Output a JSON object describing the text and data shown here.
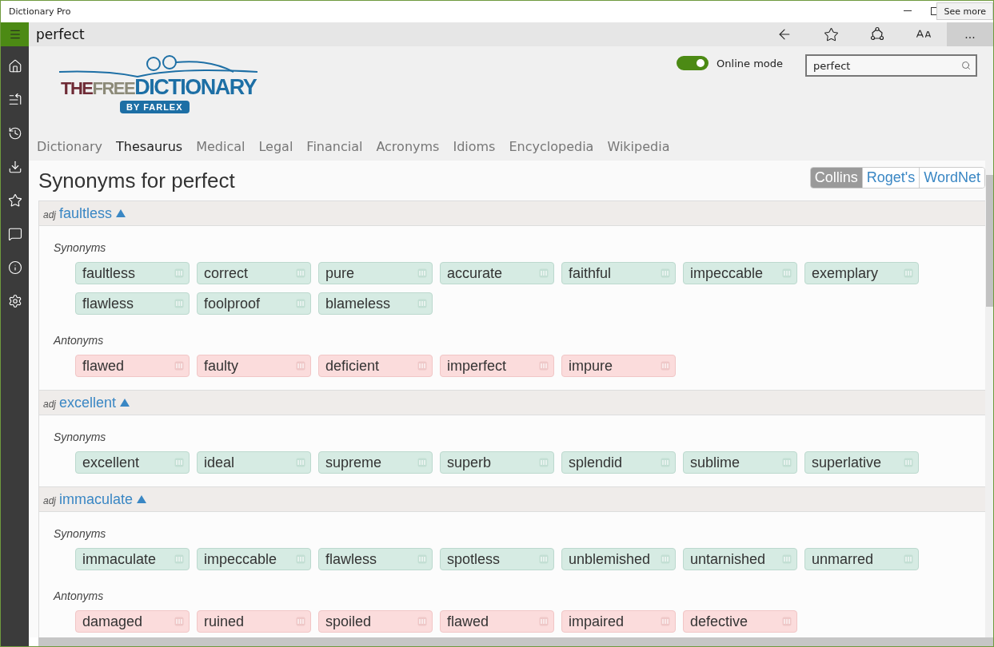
{
  "window": {
    "title": "Dictionary Pro",
    "tooltip": "See more"
  },
  "app_bar": {
    "query": "perfect",
    "more_button": "..."
  },
  "online_mode": {
    "label": "Online mode",
    "on": true
  },
  "search": {
    "value": "perfect"
  },
  "logo": {
    "the": "THE",
    "free": "FREE",
    "dictionary": "DICTIONARY",
    "byline": "BY FARLEX"
  },
  "tabs": [
    {
      "label": "Dictionary",
      "selected": false
    },
    {
      "label": "Thesaurus",
      "selected": true
    },
    {
      "label": "Medical",
      "selected": false
    },
    {
      "label": "Legal",
      "selected": false
    },
    {
      "label": "Financial",
      "selected": false
    },
    {
      "label": "Acronyms",
      "selected": false
    },
    {
      "label": "Idioms",
      "selected": false
    },
    {
      "label": "Encyclopedia",
      "selected": false
    },
    {
      "label": "Wikipedia",
      "selected": false
    }
  ],
  "heading": "Synonyms for perfect",
  "sources": [
    {
      "label": "Collins",
      "selected": true
    },
    {
      "label": "Roget's",
      "selected": false
    },
    {
      "label": "WordNet",
      "selected": false
    }
  ],
  "senses": [
    {
      "pos": "adj",
      "word": "faultless",
      "expanded": true,
      "groups": [
        {
          "kind": "synonyms",
          "label": "Synonyms",
          "words": [
            "faultless",
            "correct",
            "pure",
            "accurate",
            "faithful",
            "impeccable",
            "exemplary",
            "flawless",
            "foolproof",
            "blameless"
          ]
        },
        {
          "kind": "antonyms",
          "label": "Antonyms",
          "words": [
            "flawed",
            "faulty",
            "deficient",
            "imperfect",
            "impure"
          ]
        }
      ]
    },
    {
      "pos": "adj",
      "word": "excellent",
      "expanded": true,
      "groups": [
        {
          "kind": "synonyms",
          "label": "Synonyms",
          "words": [
            "excellent",
            "ideal",
            "supreme",
            "superb",
            "splendid",
            "sublime",
            "superlative"
          ]
        }
      ]
    },
    {
      "pos": "adj",
      "word": "immaculate",
      "expanded": true,
      "groups": [
        {
          "kind": "synonyms",
          "label": "Synonyms",
          "words": [
            "immaculate",
            "impeccable",
            "flawless",
            "spotless",
            "unblemished",
            "untarnished",
            "unmarred"
          ]
        },
        {
          "kind": "antonyms",
          "label": "Antonyms",
          "words": [
            "damaged",
            "ruined",
            "spoiled",
            "flawed",
            "impaired",
            "defective"
          ]
        }
      ]
    }
  ]
}
